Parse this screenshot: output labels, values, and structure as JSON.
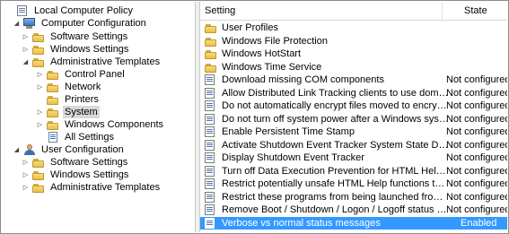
{
  "tree": {
    "items": [
      {
        "label": "Local Computer Policy",
        "icon": "policy-icon",
        "twisty": ""
      },
      {
        "label": "Computer Configuration",
        "icon": "computer-icon",
        "twisty": "expanded"
      },
      {
        "label": "Software Settings",
        "icon": "folder-icon",
        "twisty": "collapsed"
      },
      {
        "label": "Windows Settings",
        "icon": "folder-icon",
        "twisty": "collapsed"
      },
      {
        "label": "Administrative Templates",
        "icon": "folder-icon",
        "twisty": "expanded"
      },
      {
        "label": "Control Panel",
        "icon": "folder-icon",
        "twisty": "collapsed"
      },
      {
        "label": "Network",
        "icon": "folder-icon",
        "twisty": "collapsed"
      },
      {
        "label": "Printers",
        "icon": "folder-icon",
        "twisty": ""
      },
      {
        "label": "System",
        "icon": "folder-icon",
        "twisty": "collapsed",
        "selected": true
      },
      {
        "label": "Windows Components",
        "icon": "folder-icon",
        "twisty": "collapsed"
      },
      {
        "label": "All Settings",
        "icon": "all-settings-icon",
        "twisty": ""
      },
      {
        "label": "User Configuration",
        "icon": "user-icon",
        "twisty": "expanded"
      },
      {
        "label": "Software Settings",
        "icon": "folder-icon",
        "twisty": "collapsed"
      },
      {
        "label": "Windows Settings",
        "icon": "folder-icon",
        "twisty": "collapsed"
      },
      {
        "label": "Administrative Templates",
        "icon": "folder-icon",
        "twisty": "collapsed"
      }
    ]
  },
  "list": {
    "headers": {
      "setting": "Setting",
      "state": "State"
    },
    "rows": [
      {
        "name": "User Profiles",
        "state": "",
        "type": "folder"
      },
      {
        "name": "Windows File Protection",
        "state": "",
        "type": "folder"
      },
      {
        "name": "Windows HotStart",
        "state": "",
        "type": "folder"
      },
      {
        "name": "Windows Time Service",
        "state": "",
        "type": "folder"
      },
      {
        "name": "Download missing COM components",
        "state": "Not configured",
        "type": "setting"
      },
      {
        "name": "Allow Distributed Link Tracking clients to use domain resour...",
        "state": "Not configured",
        "type": "setting"
      },
      {
        "name": "Do not automatically encrypt files moved to encrypted fold...",
        "state": "Not configured",
        "type": "setting"
      },
      {
        "name": "Do not turn off system power after a Windows system shutd...",
        "state": "Not configured",
        "type": "setting"
      },
      {
        "name": "Enable Persistent Time Stamp",
        "state": "Not configured",
        "type": "setting"
      },
      {
        "name": "Activate Shutdown Event Tracker System State Data feature",
        "state": "Not configured",
        "type": "setting"
      },
      {
        "name": "Display Shutdown Event Tracker",
        "state": "Not configured",
        "type": "setting"
      },
      {
        "name": "Turn off Data Execution Prevention for HTML Help Executible",
        "state": "Not configured",
        "type": "setting"
      },
      {
        "name": "Restrict potentially unsafe HTML Help functions to specified...",
        "state": "Not configured",
        "type": "setting"
      },
      {
        "name": "Restrict these programs from being launched from Help",
        "state": "Not configured",
        "type": "setting"
      },
      {
        "name": "Remove Boot / Shutdown / Logon / Logoff status messages",
        "state": "Not configured",
        "type": "setting"
      },
      {
        "name": "Verbose vs normal status messages",
        "state": "Enabled",
        "type": "setting",
        "selected": true
      }
    ]
  },
  "colors": {
    "selection": "#3399ff",
    "tree_selection": "#d9d9d9",
    "folder": "#e8bd4b"
  }
}
